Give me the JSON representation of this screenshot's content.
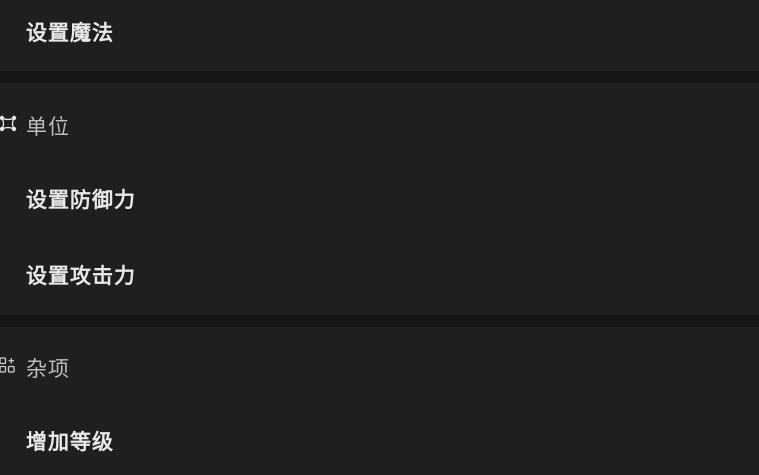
{
  "menu": {
    "top_item": {
      "label": "设置魔法"
    },
    "sections": [
      {
        "title": "单位",
        "icon": "unit-nodes-icon",
        "items": [
          {
            "label": "设置防御力"
          },
          {
            "label": "设置攻击力"
          }
        ]
      },
      {
        "title": "杂项",
        "icon": "misc-grid-plus-icon",
        "items": [
          {
            "label": "增加等级"
          }
        ]
      }
    ]
  },
  "colors": {
    "page_background": "#161616",
    "panel_background": "#1f1f1f",
    "item_text": "#e8e8e8",
    "section_text": "#bdbdbd"
  }
}
